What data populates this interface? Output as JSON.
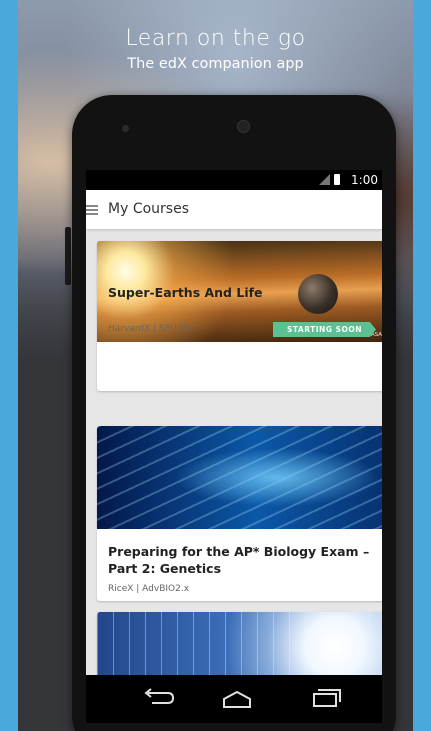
{
  "promo": {
    "headline": "Learn on the go",
    "subline": "The edX companion app"
  },
  "status_bar": {
    "time": "1:00"
  },
  "app_bar": {
    "title": "My Courses"
  },
  "courses": [
    {
      "title": "Super-Earths And Life",
      "meta": "HarvardX | SPU30x",
      "badge": "STARTING SOON",
      "image_credit": "Image courtesy of NASA"
    },
    {
      "title": "Preparing for the AP* Biology Exam – Part 2: Genetics",
      "meta": "RiceX | AdvBIO2.x"
    }
  ],
  "colors": {
    "badge_green": "#5cc192",
    "side_accent": "#4aa8db",
    "phone_body": "#121212"
  },
  "icons": {
    "menu": "hamburger-icon",
    "back": "back-arrow-icon",
    "home": "home-icon",
    "recent": "recent-apps-icon"
  }
}
